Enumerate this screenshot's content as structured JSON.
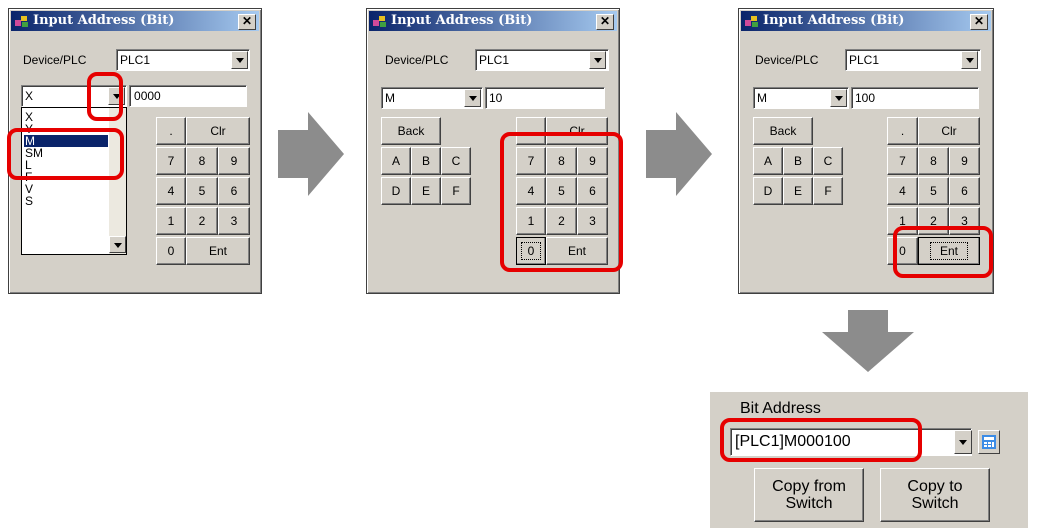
{
  "dialog_title": "Input Address (Bit)",
  "close_glyph": "✕",
  "device_label": "Device/PLC",
  "device_value": "PLC1",
  "keys": {
    "dot": ".",
    "clr": "Clr",
    "back": "Back",
    "ent": "Ent",
    "a": "A",
    "b": "B",
    "c": "C",
    "d": "D",
    "e": "E",
    "f": "F",
    "k7": "7",
    "k8": "8",
    "k9": "9",
    "k4": "4",
    "k5": "5",
    "k6": "6",
    "k1": "1",
    "k2": "2",
    "k3": "3",
    "k0": "0"
  },
  "step1": {
    "device_type": "X",
    "address": "000",
    "address_partial": "0",
    "list": [
      "X",
      "Y",
      "M",
      "SM",
      "L",
      "F",
      "V",
      "S"
    ],
    "selected": "M"
  },
  "step2": {
    "device_type": "M",
    "address": "10"
  },
  "step3": {
    "device_type": "M",
    "address": "100"
  },
  "bit_panel": {
    "label": "Bit Address",
    "value": "[PLC1]M000100",
    "copy_from": [
      "Copy from",
      "Switch"
    ],
    "copy_to": [
      "Copy to",
      "Switch"
    ]
  },
  "colors": {
    "highlight": "#e60000",
    "arrow": "#8c8c8c",
    "dialog_bg": "#d4d0c8",
    "titlebar": "#0a246a"
  }
}
